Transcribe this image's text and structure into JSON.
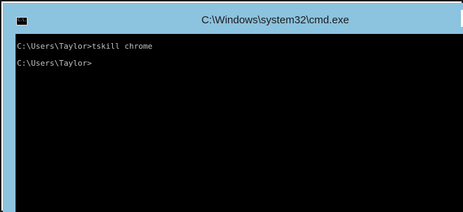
{
  "window": {
    "title": "C:\\Windows\\system32\\cmd.exe",
    "icon": "cmd-icon",
    "icon_text": "C:\\."
  },
  "console": {
    "lines": [
      "C:\\Users\\Taylor>tskill chrome",
      "C:\\Users\\Taylor>"
    ]
  },
  "colors": {
    "titlebar": "#8cc3df",
    "console_bg": "#000000",
    "console_text": "#c0c0c0"
  }
}
